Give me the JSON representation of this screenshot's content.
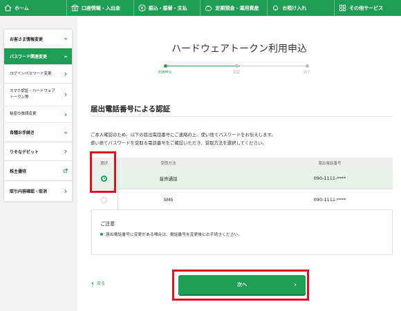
{
  "colors": {
    "brand_green": "#1f9d55",
    "highlight_red": "#e0101a",
    "selected_row": "#e6f3ea"
  },
  "topnav": [
    {
      "label": "ホーム",
      "icon": "home-icon"
    },
    {
      "label": "口座情報・入出金",
      "icon": "bank-icon"
    },
    {
      "label": "振込・振替・支払",
      "icon": "yen-transfer-icon"
    },
    {
      "label": "定期預金・運用資産",
      "icon": "savings-icon"
    },
    {
      "label": "お預け入れ",
      "icon": "bell-icon"
    },
    {
      "label": "その他サービス",
      "icon": "menu-grid-icon"
    }
  ],
  "sidebar": {
    "customer_info": "お客さま情報変更",
    "password_related": "パスワード関連変更",
    "login_password": "ログインパスワード変更",
    "smartphone_auth_line1": "スマホ認証・ハードウェア",
    "smartphone_auth_line2": "トークン等",
    "secret_question": "秘密の質問変更",
    "procedures": "各種お手続き",
    "debit": "りそなデビット",
    "shareholder": "株主優待",
    "transaction_history": "取引内容確認・取消"
  },
  "page": {
    "title": "ハードウェアトークン利用申込",
    "steps": [
      {
        "label": "利用申込"
      },
      {
        "label": "認証"
      },
      {
        "label": "完了"
      }
    ],
    "section_title": "届出電話番号による認証",
    "description_line1": "ご本人確認のため、以下の届出電話番号にご連絡の上、使い捨てパスワードをお伝えします。",
    "description_line2": "使い捨てパスワードを受取る電話番号をご確認いただき、受取方法を選択してください。"
  },
  "table": {
    "headers": {
      "select": "選択",
      "method": "受取方法",
      "phone": "届出電話番号"
    },
    "rows": [
      {
        "method": "音声通話",
        "phone": "090-1111-****",
        "selected": true
      },
      {
        "method": "SMS",
        "phone": "090-1111-****",
        "selected": false
      }
    ]
  },
  "notice": {
    "title": "ご注意",
    "text": "届出電話番号に変更がある場合は、電話番号を変更後にお手続きください。"
  },
  "actions": {
    "back": "戻る",
    "next": "次へ"
  }
}
